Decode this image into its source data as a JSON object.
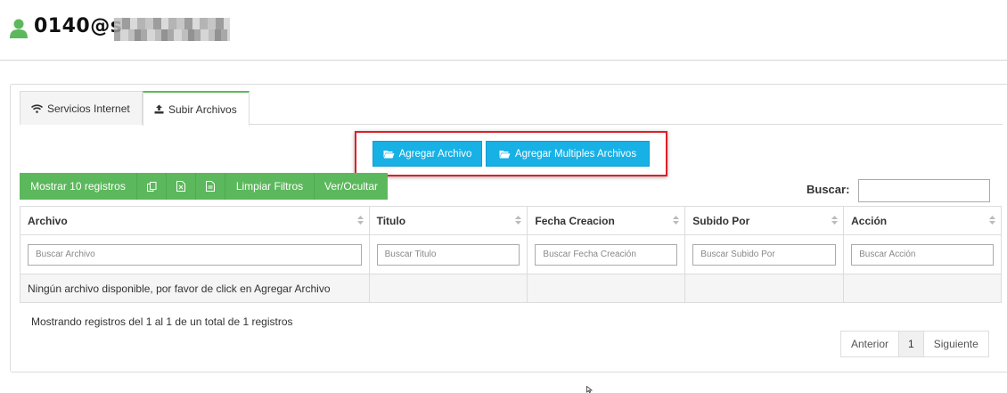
{
  "header": {
    "username": "0140@s"
  },
  "tabs": [
    {
      "label": "Servicios Internet",
      "icon": "wifi-icon"
    },
    {
      "label": "Subir Archivos",
      "icon": "upload-icon"
    }
  ],
  "actions": {
    "add_file": "Agregar Archivo",
    "add_multiple": "Agregar Multiples Archivos"
  },
  "toolbar": {
    "show_records": "Mostrar 10 registros",
    "clear_filters": "Limpiar Filtros",
    "toggle_columns": "Ver/Ocultar"
  },
  "search": {
    "label": "Buscar:",
    "value": ""
  },
  "table": {
    "columns": [
      "Archivo",
      "Titulo",
      "Fecha Creacion",
      "Subido Por",
      "Acción"
    ],
    "filters": [
      "Buscar Archivo",
      "Buscar Titulo",
      "Buscar Fecha Creación",
      "Buscar Subido Por",
      "Buscar Acción"
    ],
    "empty_message": "Ningún archivo disponible, por favor de click en Agregar Archivo"
  },
  "footer": {
    "info": "Mostrando registros del 1 al 1 de un total de 1 registros",
    "prev": "Anterior",
    "page": "1",
    "next": "Siguiente"
  },
  "colors": {
    "accent_green": "#5cb85c",
    "info_blue": "#17b1e6",
    "highlight_red": "#e01f26"
  }
}
